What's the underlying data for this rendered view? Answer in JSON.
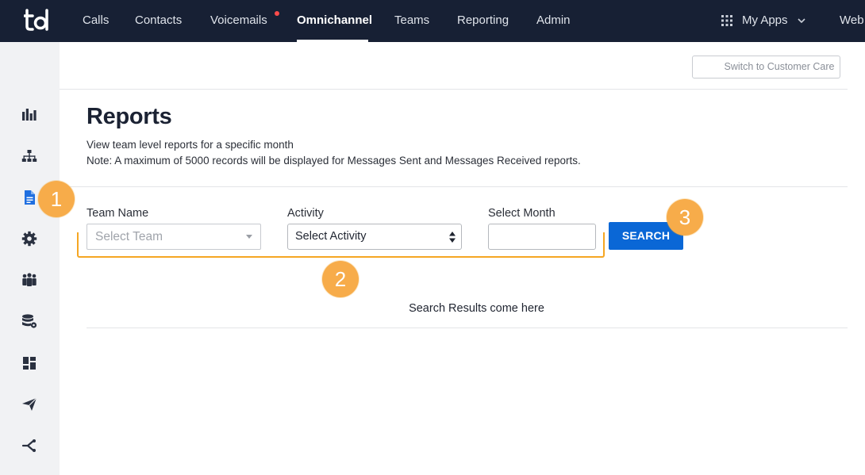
{
  "app": {
    "logo_text": "td"
  },
  "nav": {
    "items": [
      {
        "label": "Calls"
      },
      {
        "label": "Contacts"
      },
      {
        "label": "Voicemails"
      },
      {
        "label": "Omnichannel"
      },
      {
        "label": "Teams"
      },
      {
        "label": "Reporting"
      },
      {
        "label": "Admin"
      }
    ],
    "active": "Omnichannel",
    "my_apps_label": "My Apps",
    "web_label": "Web"
  },
  "sidebar": {
    "icons": [
      "bar-chart-icon",
      "org-chart-icon",
      "document-icon",
      "gear-icon",
      "people-icon",
      "database-settings-icon",
      "dashboard-icon",
      "send-icon",
      "connector-icon"
    ],
    "active": "document-icon"
  },
  "header": {
    "switch_label": "Switch to Customer Care"
  },
  "page": {
    "title": "Reports",
    "description": "View team level reports for a specific month",
    "note": "Note: A maximum of 5000 records will be displayed for Messages Sent and Messages Received reports."
  },
  "form": {
    "team_label": "Team Name",
    "team_placeholder": "Select Team",
    "activity_label": "Activity",
    "activity_value": "Select Activity",
    "month_label": "Select Month",
    "month_value": "",
    "search_label": "SEARCH"
  },
  "results": {
    "placeholder": "Search Results come here"
  },
  "annotations": {
    "badges": [
      "1",
      "2",
      "3"
    ],
    "color": "#f7ac4a"
  },
  "colors": {
    "nav_bg": "#172034",
    "accent": "#0a67d6",
    "annotation": "#f5a623"
  }
}
